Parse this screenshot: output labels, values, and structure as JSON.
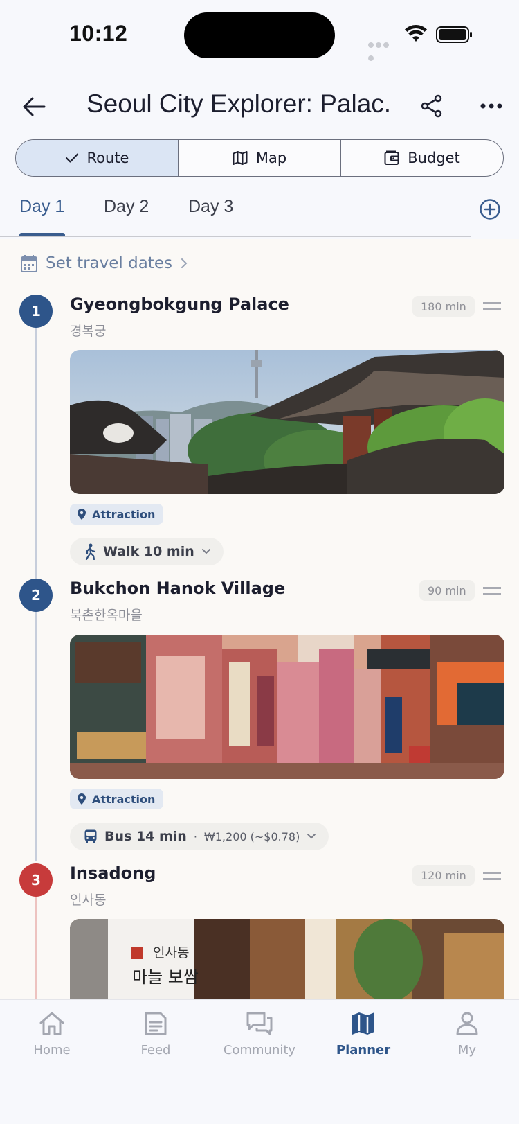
{
  "status_bar": {
    "time": "10:12"
  },
  "header": {
    "title": "Seoul City Explorer: Palac..."
  },
  "segments": [
    {
      "label": "Route",
      "icon": "check-icon",
      "active": true
    },
    {
      "label": "Map",
      "icon": "map-icon",
      "active": false
    },
    {
      "label": "Budget",
      "icon": "wallet-icon",
      "active": false
    }
  ],
  "day_tabs": [
    {
      "label": "Day 1",
      "active": true
    },
    {
      "label": "Day 2",
      "active": false
    },
    {
      "label": "Day 3",
      "active": false
    }
  ],
  "dates": {
    "label": "Set travel dates"
  },
  "stops": [
    {
      "number": "1",
      "name": "Gyeongbokgung Palace",
      "local_name": "경복궁",
      "duration": "180 min",
      "category": "Attraction",
      "marker_color": "#2e558a"
    },
    {
      "number": "2",
      "name": "Bukchon Hanok Village",
      "local_name": "북촌한옥마을",
      "duration": "90 min",
      "category": "Attraction",
      "marker_color": "#2e558a"
    },
    {
      "number": "3",
      "name": "Insadong",
      "local_name": "인사동",
      "duration": "120 min",
      "marker_color": "#c73b3b"
    }
  ],
  "transits": [
    {
      "mode": "Walk 10 min",
      "icon": "walk-icon",
      "fare": ""
    },
    {
      "mode": "Bus 14 min",
      "icon": "bus-icon",
      "separator": "·",
      "fare": "₩1,200 (~$0.78)"
    }
  ],
  "photo_sign": {
    "line1": "인사동",
    "line2": "마늘 보쌈"
  },
  "bottom_nav": [
    {
      "label": "Home",
      "icon": "home-icon",
      "active": false
    },
    {
      "label": "Feed",
      "icon": "feed-icon",
      "active": false
    },
    {
      "label": "Community",
      "icon": "community-icon",
      "active": false
    },
    {
      "label": "Planner",
      "icon": "planner-icon",
      "active": true
    },
    {
      "label": "My",
      "icon": "profile-icon",
      "active": false
    }
  ],
  "colors": {
    "accent": "#3a5d8f",
    "marker_blue": "#2e558a",
    "marker_red": "#c73b3b",
    "background": "#fbf9f6"
  }
}
